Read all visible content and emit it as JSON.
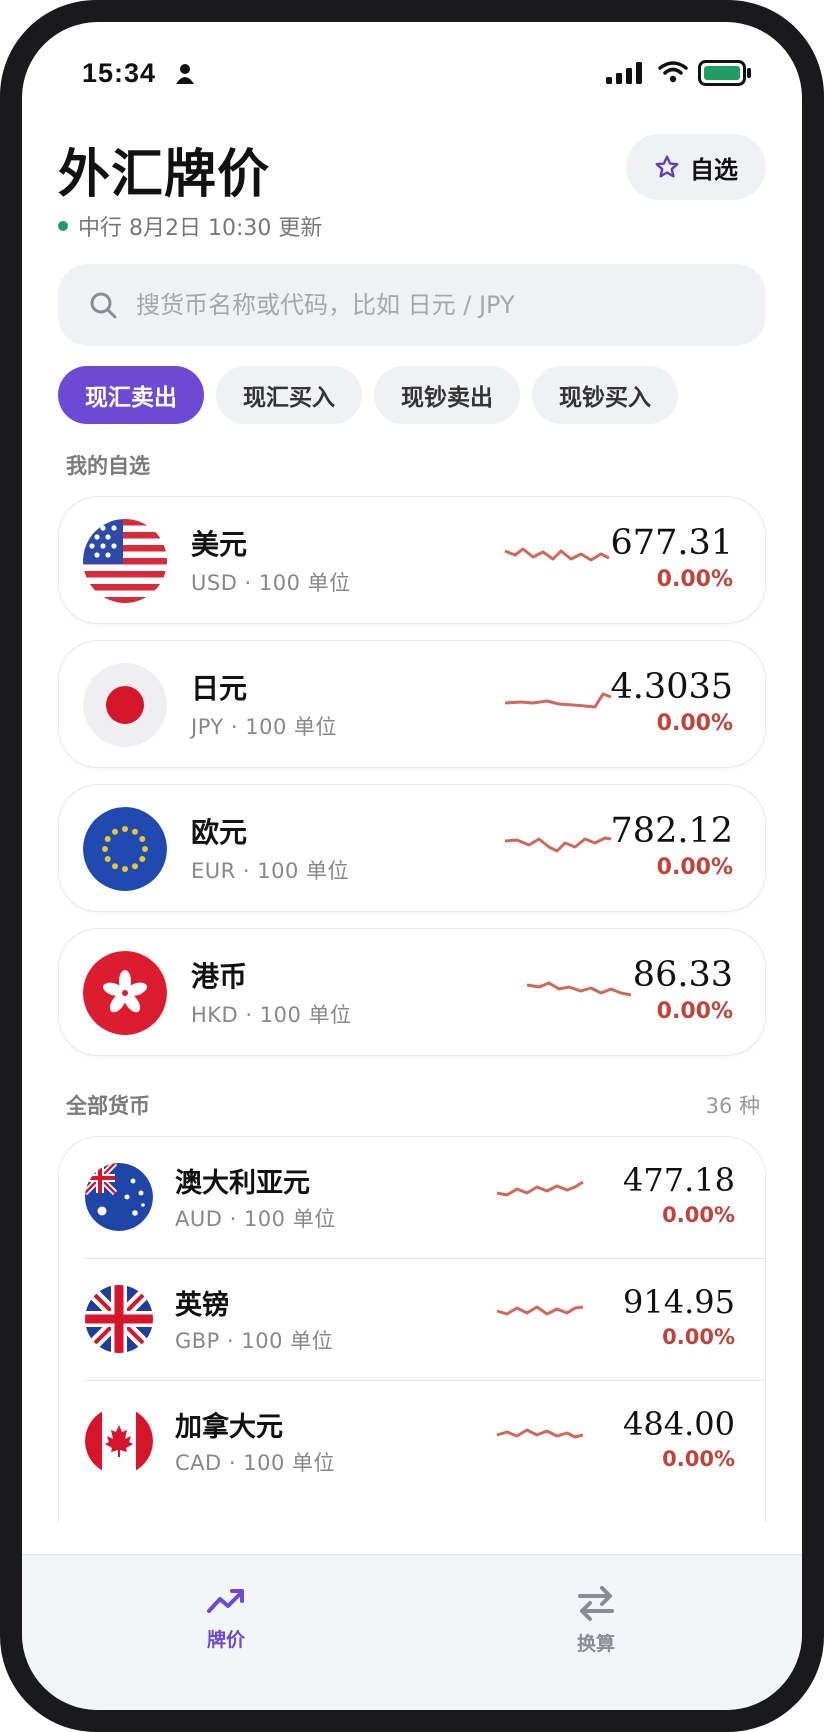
{
  "status": {
    "time": "15:34"
  },
  "header": {
    "title": "外汇牌价",
    "favorites_label": "自选",
    "update_text": "中行 8月2日 10:30 更新",
    "update_dot_color": "#1e9e62"
  },
  "search": {
    "placeholder": "搜货币名称或代码，比如 日元 / JPY"
  },
  "tabs": [
    {
      "label": "现汇卖出",
      "active": true
    },
    {
      "label": "现汇买入",
      "active": false
    },
    {
      "label": "现钞卖出",
      "active": false
    },
    {
      "label": "现钞买入",
      "active": false
    }
  ],
  "favorites": {
    "section_label": "我的自选",
    "items": [
      {
        "name": "美元",
        "code": "USD · 100 单位",
        "price": "677.31",
        "change": "0.00%",
        "flag": "us-flag-icon"
      },
      {
        "name": "日元",
        "code": "JPY · 100 单位",
        "price": "4.3035",
        "change": "0.00%",
        "flag": "japan-flag-icon"
      },
      {
        "name": "欧元",
        "code": "EUR · 100 单位",
        "price": "782.12",
        "change": "0.00%",
        "flag": "eu-flag-icon"
      },
      {
        "name": "港币",
        "code": "HKD · 100 单位",
        "price": "86.33",
        "change": "0.00%",
        "flag": "hong-kong-flag-icon"
      }
    ]
  },
  "all_currencies": {
    "section_label": "全部货币",
    "count": "36 种",
    "items": [
      {
        "name": "澳大利亚元",
        "code": "AUD · 100 单位",
        "price": "477.18",
        "change": "0.00%",
        "flag": "australia-flag-icon"
      },
      {
        "name": "英镑",
        "code": "GBP · 100 单位",
        "price": "914.95",
        "change": "0.00%",
        "flag": "uk-flag-icon"
      },
      {
        "name": "加拿大元",
        "code": "CAD · 100 单位",
        "price": "484.00",
        "change": "0.00%",
        "flag": "canada-flag-icon"
      }
    ]
  },
  "nav": {
    "rates_label": "牌价",
    "convert_label": "换算",
    "active": "rates"
  },
  "colors": {
    "accent": "#6d4ad6",
    "change_red": "#c0443a",
    "spark_red": "#d0685c"
  }
}
